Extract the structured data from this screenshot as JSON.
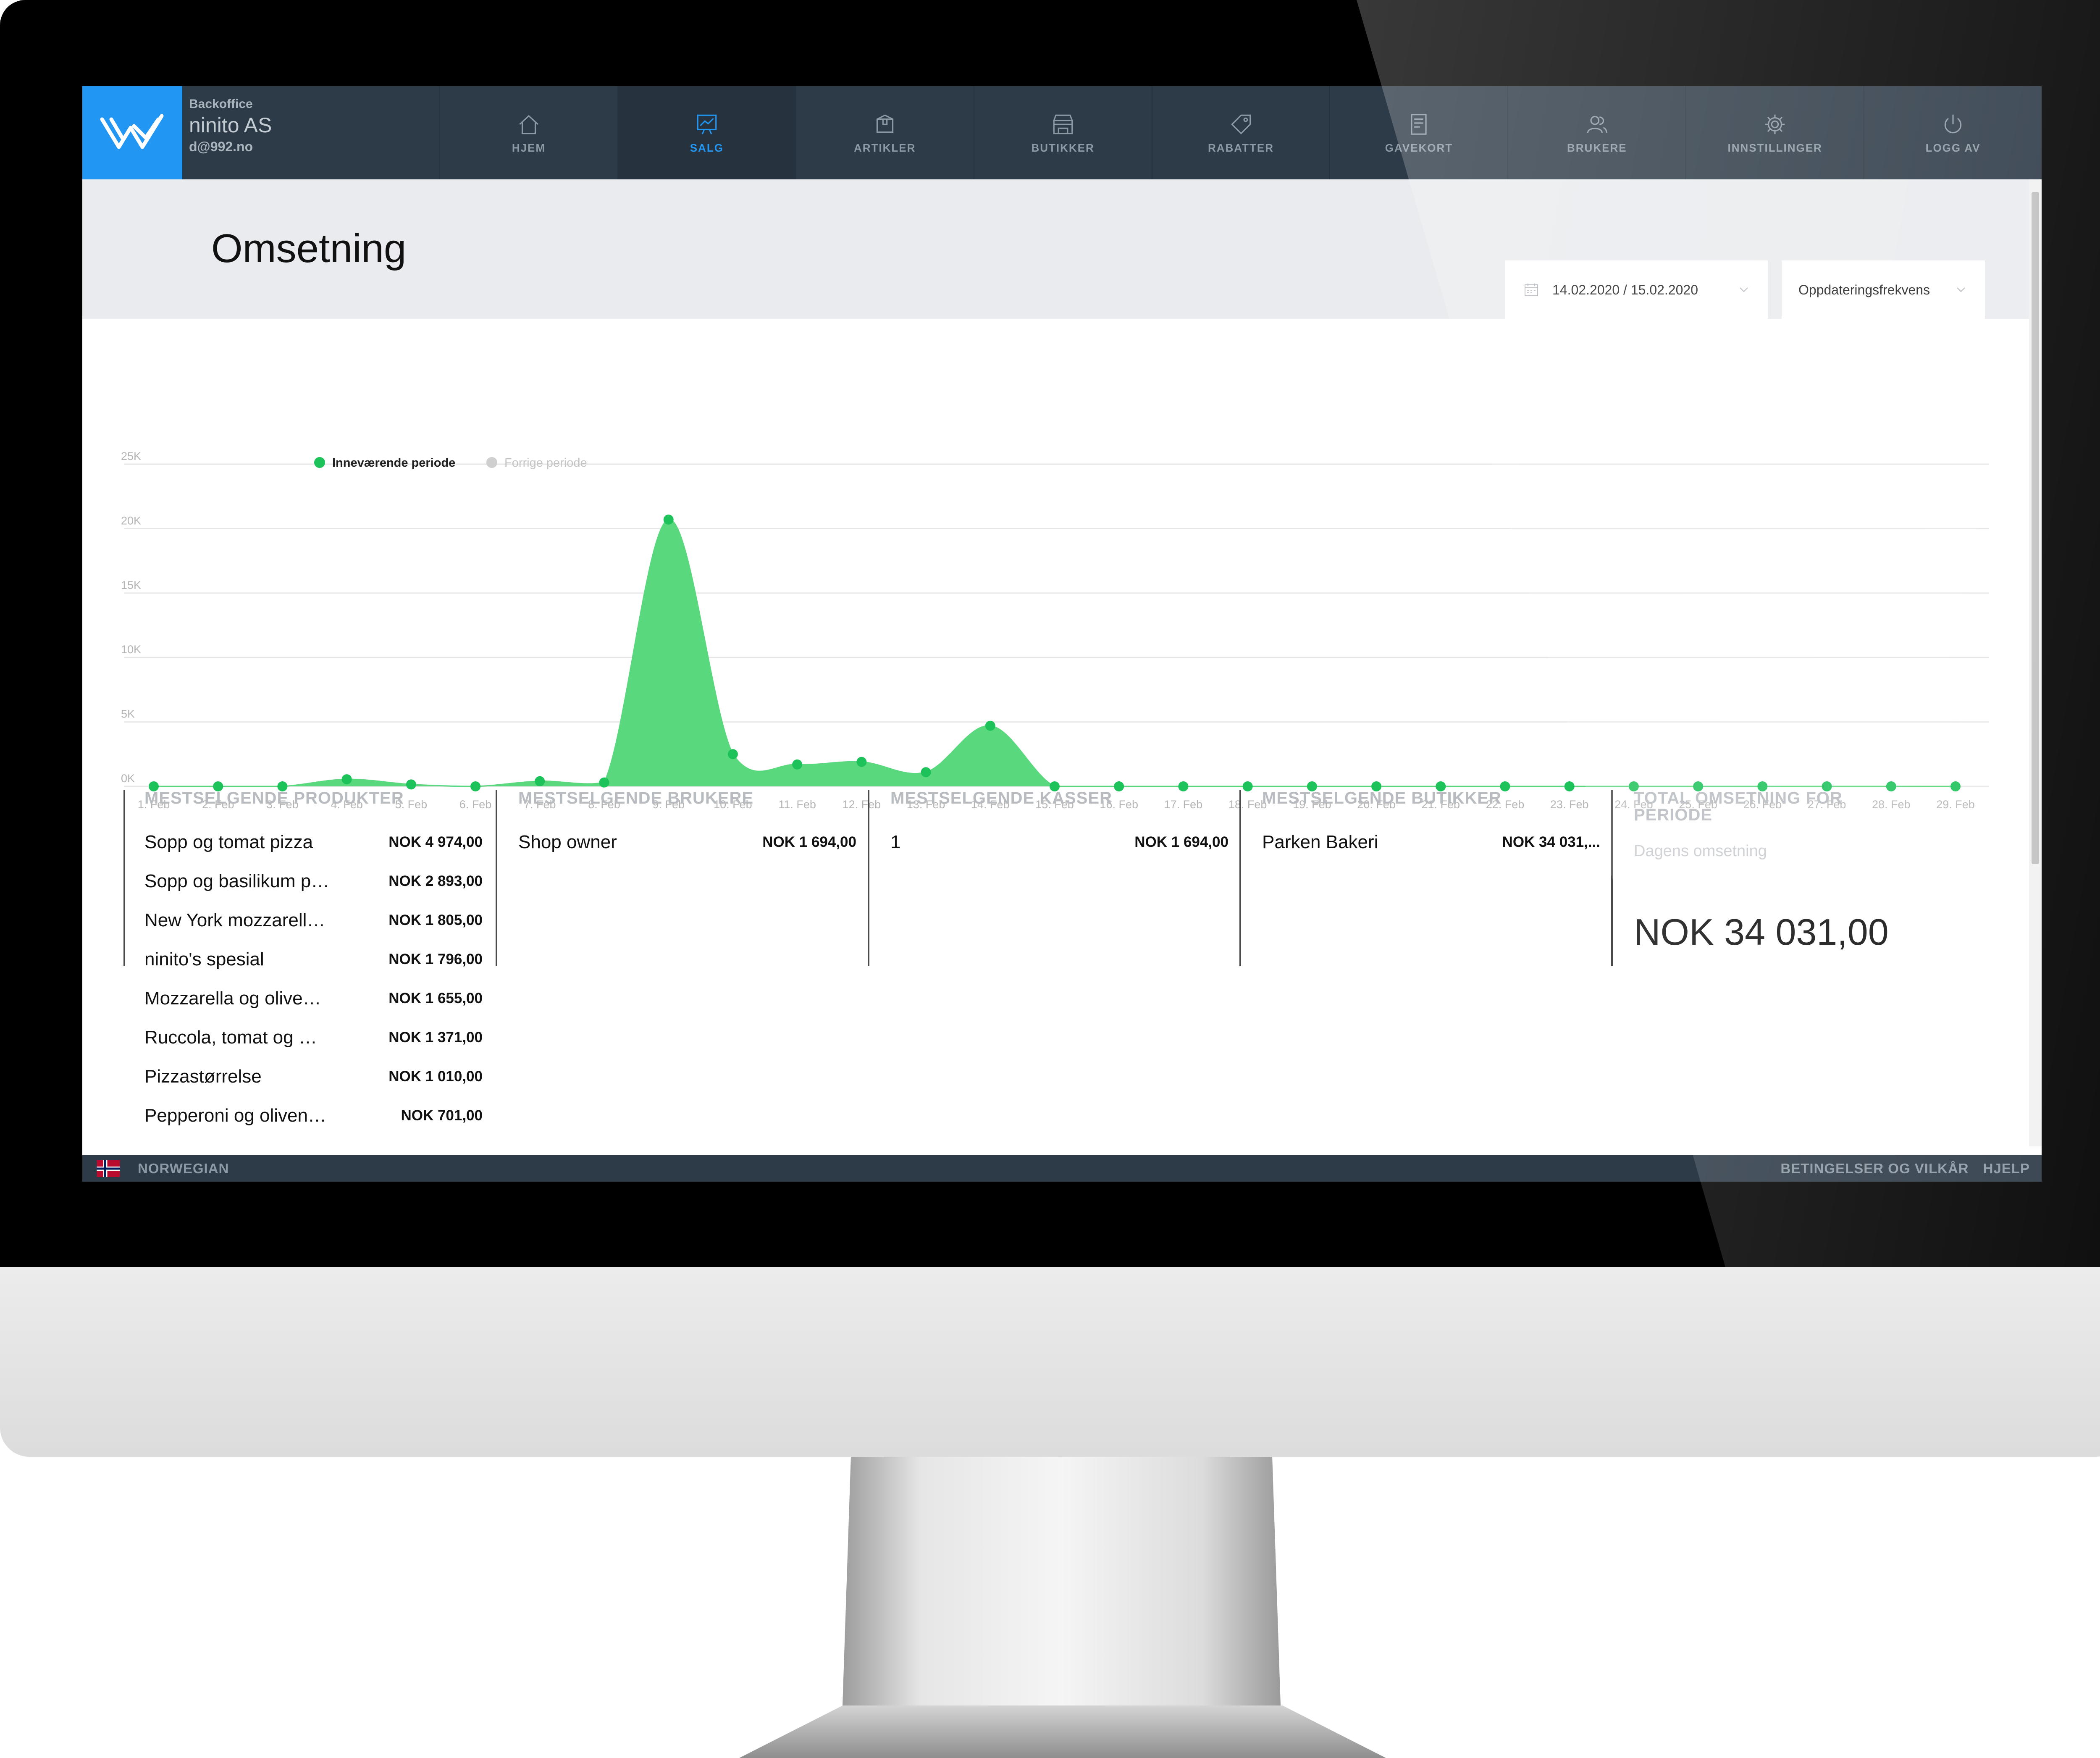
{
  "brand": {
    "app_name": "Backoffice",
    "company": "ninito AS",
    "email": "d@992.no"
  },
  "nav": [
    {
      "label": "HJEM",
      "icon": "home-icon"
    },
    {
      "label": "SALG",
      "icon": "sales-chart-icon",
      "active": true
    },
    {
      "label": "ARTIKLER",
      "icon": "box-icon"
    },
    {
      "label": "BUTIKKER",
      "icon": "store-icon"
    },
    {
      "label": "RABATTER",
      "icon": "tag-icon"
    },
    {
      "label": "GAVEKORT",
      "icon": "giftcard-icon"
    },
    {
      "label": "BRUKERE",
      "icon": "users-icon"
    },
    {
      "label": "INNSTILLINGER",
      "icon": "gear-icon"
    },
    {
      "label": "LOGG AV",
      "icon": "power-icon"
    }
  ],
  "page": {
    "title": "Omsetning",
    "date_range": "14.02.2020 / 15.02.2020",
    "frequency_label": "Oppdateringsfrekvens"
  },
  "chart_data": {
    "type": "area",
    "legend": [
      {
        "name": "Inneværende periode",
        "color": "#1ec25a"
      },
      {
        "name": "Forrige periode",
        "color": "#cfcfcf"
      }
    ],
    "legend_position": "top-left",
    "grid": true,
    "ylim": [
      0,
      25000
    ],
    "y_ticks": [
      "0K",
      "5K",
      "10K",
      "15K",
      "20K",
      "25K"
    ],
    "x": [
      "1. Feb",
      "2. Feb",
      "3. Feb",
      "4. Feb",
      "5. Feb",
      "6. Feb",
      "7. Feb",
      "8. Feb",
      "9. Feb",
      "10. Feb",
      "11. Feb",
      "12. Feb",
      "13. Feb",
      "14. Feb",
      "15. Feb",
      "16. Feb",
      "17. Feb",
      "18. Feb",
      "19. Feb",
      "20. Feb",
      "21. Feb",
      "22. Feb",
      "23. Feb",
      "24. Feb",
      "25. Feb",
      "26. Feb",
      "27. Feb",
      "28. Feb",
      "29. Feb"
    ],
    "series": [
      {
        "name": "Inneværende periode",
        "color": "#1ec25a",
        "fill": "#5ad87e",
        "values": [
          0,
          0,
          0,
          550,
          150,
          0,
          400,
          300,
          20700,
          2500,
          1700,
          1900,
          1100,
          4700,
          0,
          0,
          0,
          0,
          0,
          0,
          0,
          0,
          0,
          0,
          0,
          0,
          0,
          0,
          0
        ]
      }
    ]
  },
  "stats": {
    "products": {
      "heading": "MESTSELGENDE PRODUKTER",
      "rows": [
        {
          "name": "Sopp og tomat pizza",
          "value": "NOK 4 974,00"
        },
        {
          "name": "Sopp og basilikum pizza",
          "value": "NOK 2 893,00"
        },
        {
          "name": "New York mozzarella pizza",
          "value": "NOK 1 805,00"
        },
        {
          "name": "ninito's spesial",
          "value": "NOK 1 796,00"
        },
        {
          "name": "Mozzarella og oliven pizza",
          "value": "NOK 1 655,00"
        },
        {
          "name": "Ruccola, tomat og mozzarella",
          "value": "NOK 1 371,00"
        },
        {
          "name": "Pizzastørrelse",
          "value": "NOK 1 010,00"
        },
        {
          "name": "Pepperoni og oliven pizza",
          "value": "NOK 701,00"
        }
      ]
    },
    "users": {
      "heading": "MESTSELGENDE BRUKERE",
      "rows": [
        {
          "name": "Shop owner",
          "value": "NOK 1 694,00"
        }
      ]
    },
    "registers": {
      "heading": "MESTSELGENDE KASSER",
      "rows": [
        {
          "name": "1",
          "value": "NOK 1 694,00"
        }
      ]
    },
    "stores": {
      "heading": "MESTSELGENDE BUTIKKER",
      "rows": [
        {
          "name": "Parken Bakeri",
          "value": "NOK 34 031,..."
        }
      ]
    },
    "total": {
      "heading": "TOTAL OMSETNING FOR PERIODE",
      "subtitle": "Dagens omsetning",
      "value": "NOK 34 031,00"
    }
  },
  "footer": {
    "language": "NORWEGIAN",
    "terms": "BETINGELSER OG VILKÅR",
    "help": "HJELP"
  }
}
